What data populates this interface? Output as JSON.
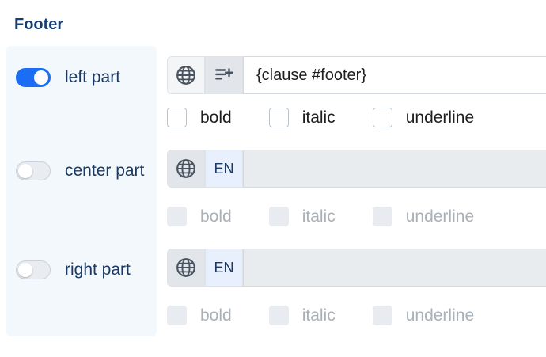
{
  "section": {
    "title": "Footer"
  },
  "parts": [
    {
      "label": "left part",
      "enabled": true,
      "value": "{clause #footer}",
      "formats": [
        "bold",
        "italic",
        "underline"
      ]
    },
    {
      "label": "center part",
      "enabled": false,
      "lang": "EN",
      "value": "",
      "formats": [
        "bold",
        "italic",
        "underline"
      ]
    },
    {
      "label": "right part",
      "enabled": false,
      "lang": "EN",
      "value": "",
      "formats": [
        "bold",
        "italic",
        "underline"
      ]
    }
  ],
  "icons": {
    "language": "globe-icon",
    "insert": "insert-list-icon"
  },
  "colors": {
    "accent": "#1b6ef3",
    "title": "#163e73",
    "label": "#1b3a63"
  }
}
